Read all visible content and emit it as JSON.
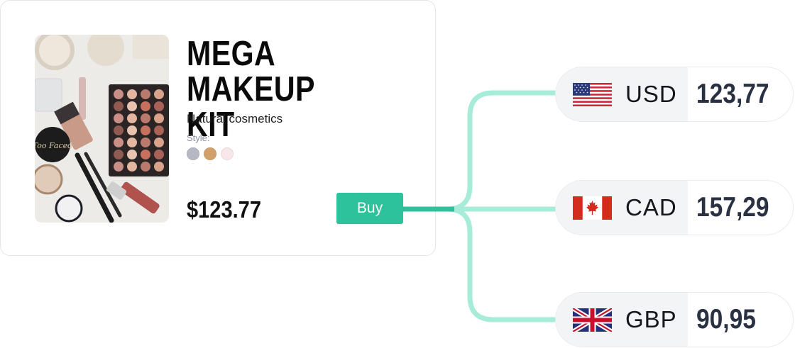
{
  "product": {
    "title": "MEGA MAKEUP KIT",
    "subtitle": "Natural cosmetics",
    "style_label": "Style:",
    "swatches": [
      "#b6b9c4",
      "#d3a06a",
      "#f9e6ea"
    ],
    "price": "$123.77",
    "buy_label": "Buy",
    "image_icon": "makeup-kit-photo"
  },
  "colors": {
    "accent": "#2dc29c",
    "connector": "#a6ecd8"
  },
  "currencies": [
    {
      "code": "USD",
      "value": "123,77",
      "flag_icon": "us-flag-icon"
    },
    {
      "code": "CAD",
      "value": "157,29",
      "flag_icon": "canada-flag-icon"
    },
    {
      "code": "GBP",
      "value": "90,95",
      "flag_icon": "uk-flag-icon"
    }
  ]
}
